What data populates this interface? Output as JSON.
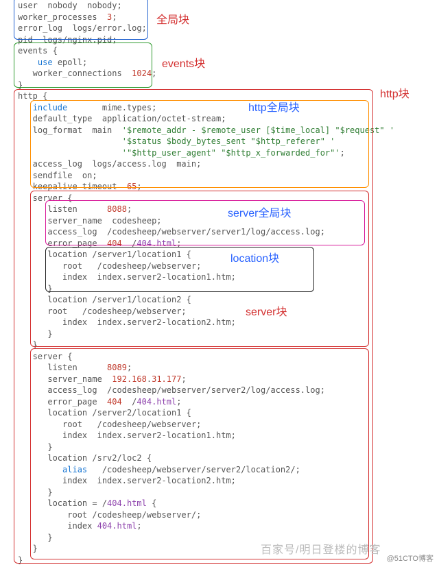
{
  "labels": {
    "global": "全局块",
    "events": "events块",
    "http": "http块",
    "http_global": "http全局块",
    "server_global": "server全局块",
    "location": "location块",
    "server": "server块"
  },
  "watermark_faint": "百家号/明日登楼的博客",
  "watermark": "@51CTO博客",
  "code": {
    "l00": "user  nobody  nobody;",
    "l01": "worker_processes  ",
    "l01n": "3",
    "l01b": ";",
    "l02": "error_log  logs/error.log;",
    "l03": "pid  logs/nginx.pid;",
    "l04": "events {",
    "l05a": "    ",
    "l05k": "use",
    "l05b": " epoll;",
    "l06": "   worker_connections  ",
    "l06n": "1024",
    "l06b": ";",
    "l07": "}",
    "l08": "http {",
    "l09a": "   ",
    "l09k": "include",
    "l09b": "       mime.types;",
    "l10": "   default_type  application/octet-stream;",
    "l11": "   log_format  main  ",
    "l11s": "'$remote_addr - $remote_user [$time_local] \"$request\" '",
    "l12s": "                     '$status $body_bytes_sent \"$http_referer\" '",
    "l13s": "                     '\"$http_user_agent\" \"$http_x_forwarded_for\"'",
    "l13b": ";",
    "l14": "   access_log  logs/access.log  main;",
    "l15": "   sendfile  on;",
    "l16": "   keepalive_timeout  ",
    "l16n": "65",
    "l16b": ";",
    "l17": "   server {",
    "l18": "      listen      ",
    "l18n": "8088",
    "l18b": ";",
    "l19": "      server_name  codesheep;",
    "l20": "      access_log  /codesheep/webserver/server1/log/access.log;",
    "l21": "      error_page  ",
    "l21n": "404",
    "l21b": "  /",
    "l21l": "404.html",
    "l21c": ";",
    "l22": "      location /server1/location1 {",
    "l23": "         root   /codesheep/webserver;",
    "l24": "         index  index.server2-location1.htm;",
    "l25": "      }",
    "l26": "      location /server1/location2 {",
    "l27": "      root   /codesheep/webserver;",
    "l28": "         index  index.server2-location2.htm;",
    "l29": "      }",
    "l30": "   }",
    "l31": "   server {",
    "l32": "      listen      ",
    "l32n": "8089",
    "l32b": ";",
    "l33": "      server_name  ",
    "l33n": "192.168",
    "l33d": ".",
    "l33n2": "31.177",
    "l33b": ";",
    "l34": "      access_log  /codesheep/webserver/server2/log/access.log;",
    "l35": "      error_page  ",
    "l35n": "404",
    "l35b": "  /",
    "l35l": "404.html",
    "l35c": ";",
    "l36": "      location /server2/location1 {",
    "l37": "         root   /codesheep/webserver;",
    "l38": "         index  index.server2-location1.htm;",
    "l39": "      }",
    "l40": "      location /srv2/loc2 {",
    "l41a": "         ",
    "l41k": "alias",
    "l41b": "   /codesheep/webserver/server2/location2/;",
    "l42": "         index  index.server2-location2.htm;",
    "l43": "      }",
    "l44": "      location = /",
    "l44l": "404.html",
    "l44b": " {",
    "l45": "          root /codesheep/webserver/;",
    "l46": "          index ",
    "l46l": "404.html",
    "l46b": ";",
    "l47": "      }",
    "l48": "   }",
    "l49": "}"
  }
}
